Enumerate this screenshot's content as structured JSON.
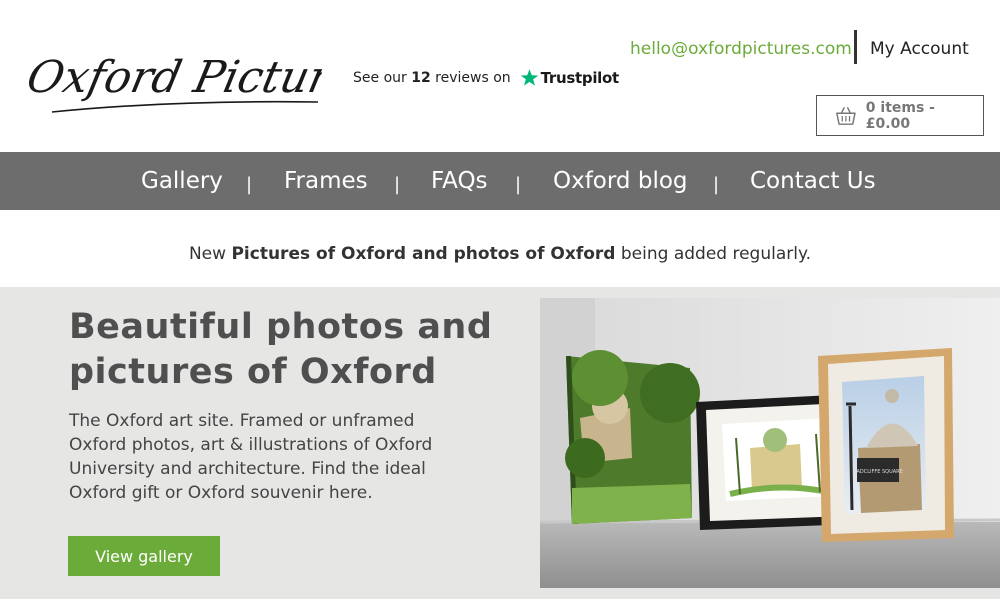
{
  "header": {
    "logo_text": "Oxford Pictures",
    "trustpilot": {
      "prefix": "See our",
      "count": "12",
      "suffix": "reviews on",
      "brand": "Trustpilot"
    },
    "email": "hello@oxfordpictures.com",
    "account_label": "My Account",
    "cart_label": "0 items - £0.00"
  },
  "nav": {
    "items": [
      {
        "label": "Gallery"
      },
      {
        "label": "Frames"
      },
      {
        "label": "FAQs"
      },
      {
        "label": "Oxford blog"
      },
      {
        "label": "Contact Us"
      }
    ],
    "separator": "|"
  },
  "announcement": {
    "prefix": "New",
    "highlight": "Pictures of Oxford and photos of Oxford",
    "suffix": "being added regularly."
  },
  "hero": {
    "title": "Beautiful photos and pictures of Oxford",
    "description": "The Oxford art site. Framed or unframed Oxford photos, art & illustrations of Oxford University and architecture. Find the ideal Oxford gift or Oxford souvenir here.",
    "button_label": "View gallery",
    "sign_text": "RADCLIFFE SQUARE"
  },
  "colors": {
    "accent_green": "#6bab3a",
    "nav_bg": "#6d6d6d",
    "hero_bg": "#e6e6e5",
    "trustpilot_star": "#00b67a"
  },
  "icons": {
    "cart": "basket-icon",
    "trustpilot": "star-icon"
  }
}
